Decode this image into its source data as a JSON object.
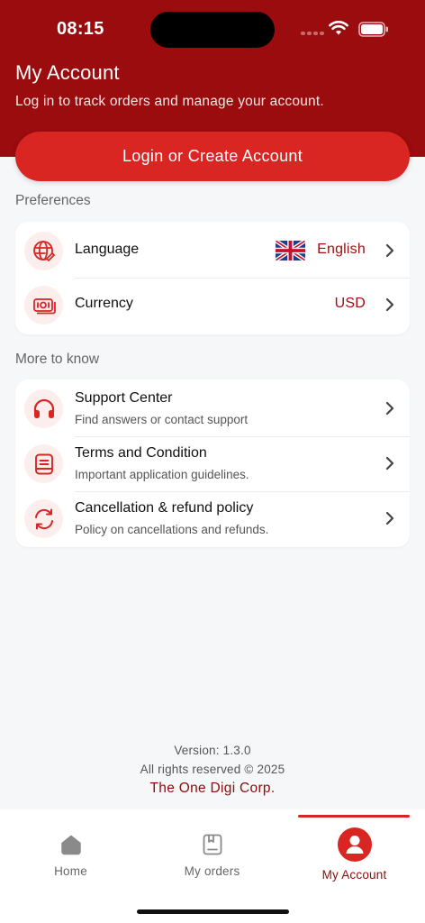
{
  "status_bar": {
    "time": "08:15"
  },
  "header": {
    "title": "My Account",
    "subtitle": "Log in to track orders and manage your account.",
    "login_label": "Login or Create Account"
  },
  "preferences": {
    "label": "Preferences",
    "items": [
      {
        "title": "Language",
        "value": "English",
        "icon": "globe-icon"
      },
      {
        "title": "Currency",
        "value": "USD",
        "icon": "currency-icon"
      }
    ]
  },
  "more": {
    "label": "More to know",
    "items": [
      {
        "title": "Support Center",
        "subtitle": "Find answers or contact support",
        "icon": "headphones-icon"
      },
      {
        "title": "Terms and Condition",
        "subtitle": "Important application guidelines.",
        "icon": "document-icon"
      },
      {
        "title": "Cancellation & refund policy",
        "subtitle": "Policy on cancellations and refunds.",
        "icon": "refresh-icon"
      }
    ]
  },
  "footer": {
    "version": "Version: 1.3.0",
    "rights": "All rights reserved © 2025",
    "company": "The One Digi Corp."
  },
  "tabs": [
    {
      "label": "Home",
      "icon": "home-icon",
      "active": false
    },
    {
      "label": "My orders",
      "icon": "orders-icon",
      "active": false
    },
    {
      "label": "My Account",
      "icon": "account-icon",
      "active": true
    }
  ],
  "colors": {
    "header_bg": "#9a0c0e",
    "accent": "#d92622",
    "accent_text": "#a01010",
    "icon_bg": "#fdeeee"
  }
}
